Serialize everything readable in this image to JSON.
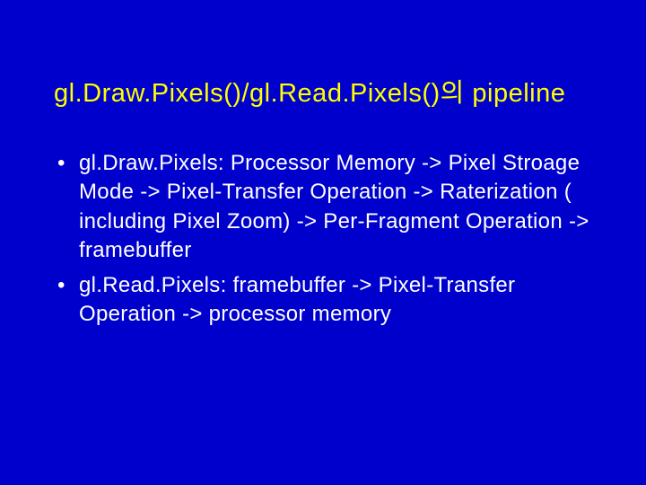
{
  "slide": {
    "title": "gl.Draw.Pixels()/gl.Read.Pixels()의 pipeline",
    "bullets": [
      "gl.Draw.Pixels: Processor Memory -> Pixel Stroage Mode -> Pixel-Transfer Operation -> Raterization ( including Pixel Zoom) -> Per-Fragment Operation -> framebuffer",
      "gl.Read.Pixels: framebuffer -> Pixel-Transfer Operation -> processor memory"
    ]
  }
}
